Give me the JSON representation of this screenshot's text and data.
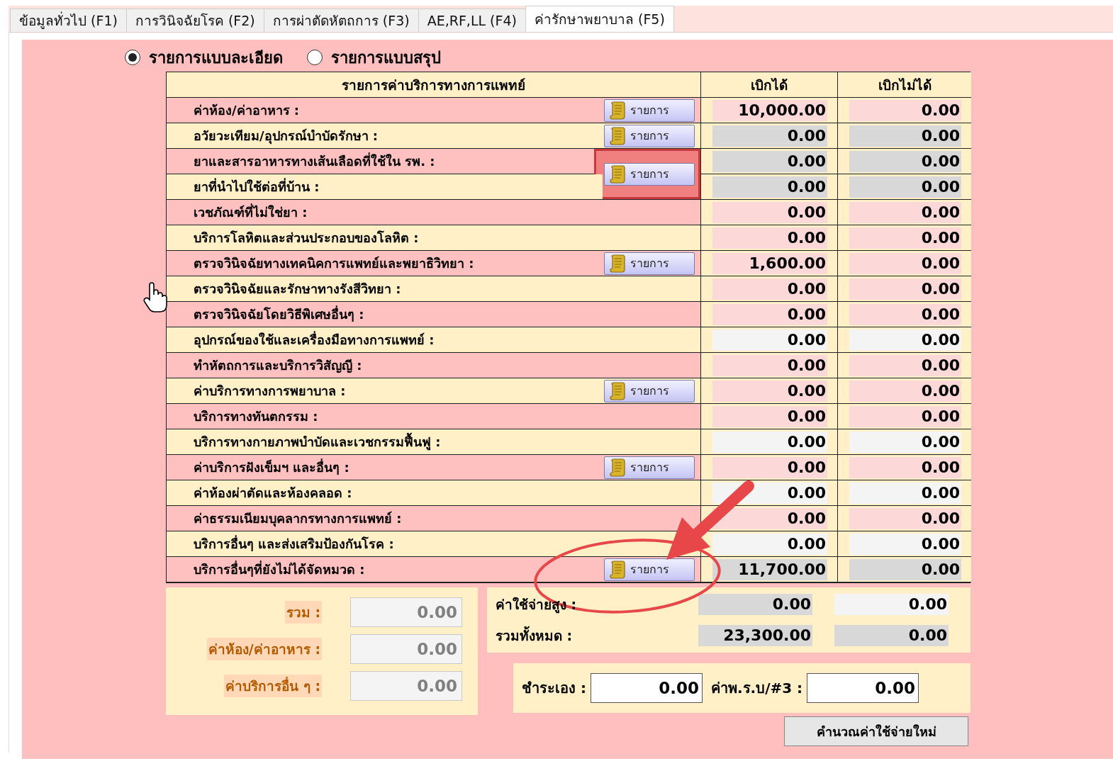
{
  "tabs": [
    {
      "label": "ข้อมูลทั่วไป (F1)",
      "selected": false
    },
    {
      "label": "การวินิจฉัยโรค (F2)",
      "selected": false
    },
    {
      "label": "การผ่าตัดหัตถการ (F3)",
      "selected": false
    },
    {
      "label": "AE,RF,LL (F4)",
      "selected": false
    },
    {
      "label": "ค่ารักษาพยาบาล (F5)",
      "selected": true
    }
  ],
  "view_options": [
    {
      "label": "รายการแบบละเอียด",
      "selected": true
    },
    {
      "label": "รายการแบบสรุป",
      "selected": false
    }
  ],
  "table": {
    "columns": [
      "รายการค่าบริการทางการแพทย์",
      "เบิกได้",
      "เบิกไม่ได้"
    ],
    "rows": [
      {
        "label": "ค่าห้อง/ค่าอาหาร :",
        "button": {
          "label": "รายการ",
          "highlighted": false
        },
        "claimable": {
          "value": "10,000.00",
          "kind": "input"
        },
        "non_claimable": {
          "value": "0.00",
          "kind": "input"
        }
      },
      {
        "label": "อวัยวะเทียม/อุปกรณ์บำบัดรักษา :",
        "button": {
          "label": "รายการ",
          "highlighted": false
        },
        "claimable": {
          "value": "0.00",
          "kind": "locked"
        },
        "non_claimable": {
          "value": "0.00",
          "kind": "locked"
        }
      },
      {
        "label": "ยาและสารอาหารทางเส้นเลือดที่ใช้ใน รพ. :",
        "button": {
          "label": "รายการ",
          "highlighted": true,
          "spans_next": true
        },
        "claimable": {
          "value": "0.00",
          "kind": "locked"
        },
        "non_claimable": {
          "value": "0.00",
          "kind": "locked"
        }
      },
      {
        "label": "ยาที่นำไปใช้ต่อที่บ้าน :",
        "claimable": {
          "value": "0.00",
          "kind": "locked"
        },
        "non_claimable": {
          "value": "0.00",
          "kind": "locked"
        }
      },
      {
        "label": "เวชภัณฑ์ที่ไม่ใช่ยา :",
        "claimable": {
          "value": "0.00",
          "kind": "input"
        },
        "non_claimable": {
          "value": "0.00",
          "kind": "input"
        }
      },
      {
        "label": "บริการโลหิตและส่วนประกอบของโลหิต :",
        "claimable": {
          "value": "0.00",
          "kind": "input"
        },
        "non_claimable": {
          "value": "0.00",
          "kind": "input"
        }
      },
      {
        "label": "ตรวจวินิจฉัยทางเทคนิคการแพทย์และพยาธิวิทยา :",
        "button": {
          "label": "รายการ",
          "highlighted": false
        },
        "claimable": {
          "value": "1,600.00",
          "kind": "input"
        },
        "non_claimable": {
          "value": "0.00",
          "kind": "input"
        }
      },
      {
        "label": "ตรวจวินิจฉัยและรักษาทางรังสีวิทยา :",
        "claimable": {
          "value": "0.00",
          "kind": "input"
        },
        "non_claimable": {
          "value": "0.00",
          "kind": "input"
        }
      },
      {
        "label": "ตรวจวินิจฉัยโดยวิธีพิเศษอื่นๆ :",
        "claimable": {
          "value": "0.00",
          "kind": "input"
        },
        "non_claimable": {
          "value": "0.00",
          "kind": "input"
        }
      },
      {
        "label": "อุปกรณ์ของใช้และเครื่องมือทางการแพทย์ :",
        "claimable": {
          "value": "0.00",
          "kind": "plain"
        },
        "non_claimable": {
          "value": "0.00",
          "kind": "plain"
        }
      },
      {
        "label": "ทำหัตถการและบริการวิสัญญี :",
        "claimable": {
          "value": "0.00",
          "kind": "input"
        },
        "non_claimable": {
          "value": "0.00",
          "kind": "input"
        }
      },
      {
        "label": "ค่าบริการทางการพยาบาล :",
        "button": {
          "label": "รายการ",
          "highlighted": false
        },
        "claimable": {
          "value": "0.00",
          "kind": "input"
        },
        "non_claimable": {
          "value": "0.00",
          "kind": "input"
        }
      },
      {
        "label": "บริการทางทันตกรรม :",
        "claimable": {
          "value": "0.00",
          "kind": "input"
        },
        "non_claimable": {
          "value": "0.00",
          "kind": "input"
        }
      },
      {
        "label": "บริการทางกายภาพบำบัดและเวชกรรมฟื้นฟู :",
        "claimable": {
          "value": "0.00",
          "kind": "plain"
        },
        "non_claimable": {
          "value": "0.00",
          "kind": "plain"
        }
      },
      {
        "label": "ค่าบริการฝังเข็มฯ และอื่นๆ :",
        "button": {
          "label": "รายการ",
          "highlighted": false
        },
        "claimable": {
          "value": "0.00",
          "kind": "input"
        },
        "non_claimable": {
          "value": "0.00",
          "kind": "input"
        }
      },
      {
        "label": "ค่าห้องผ่าตัดและห้องคลอด :",
        "claimable": {
          "value": "0.00",
          "kind": "plain"
        },
        "non_claimable": {
          "value": "0.00",
          "kind": "plain"
        }
      },
      {
        "label": "ค่าธรรมเนียมบุคลากรทางการแพทย์ :",
        "claimable": {
          "value": "0.00",
          "kind": "input"
        },
        "non_claimable": {
          "value": "0.00",
          "kind": "input"
        }
      },
      {
        "label": "บริการอื่นๆ และส่งเสริมป้องกันโรค :",
        "claimable": {
          "value": "0.00",
          "kind": "plain"
        },
        "non_claimable": {
          "value": "0.00",
          "kind": "plain"
        }
      },
      {
        "label": "บริการอื่นๆที่ยังไม่ได้จัดหมวด :",
        "button": {
          "label": "รายการ",
          "highlighted": false
        },
        "claimable": {
          "value": "11,700.00",
          "kind": "locked"
        },
        "non_claimable": {
          "value": "0.00",
          "kind": "locked"
        }
      }
    ]
  },
  "summary_left": [
    {
      "label": "รวม :",
      "value": "0.00",
      "disabled": true
    },
    {
      "label": "ค่าห้อง/ค่าอาหาร :",
      "value": "0.00",
      "disabled": true
    },
    {
      "label": "ค่าบริการอื่น ๆ :",
      "value": "0.00",
      "disabled": true
    }
  ],
  "summary_right": [
    {
      "label": "ค่าใช้จ่ายสูง :",
      "claimable": {
        "value": "0.00",
        "kind": "locked"
      },
      "non_claimable": {
        "value": "0.00",
        "kind": "plain"
      }
    },
    {
      "label": "รวมทั้งหมด :",
      "claimable": {
        "value": "23,300.00",
        "kind": "locked"
      },
      "non_claimable": {
        "value": "0.00",
        "kind": "locked"
      }
    }
  ],
  "payment": [
    {
      "label": "ชำระเอง :",
      "value": "0.00"
    },
    {
      "label": "ค่าพ.ร.บ/#3 :",
      "value": "0.00"
    }
  ],
  "recalculate_button": "คำนวณค่าใช้จ่ายใหม่"
}
